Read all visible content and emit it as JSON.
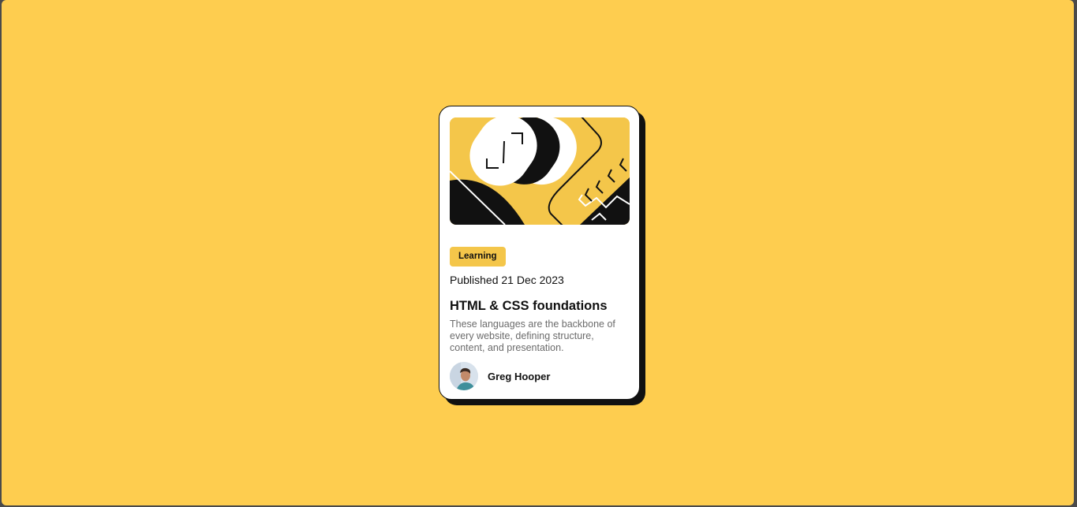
{
  "card": {
    "badge": "Learning",
    "published": "Published 21 Dec 2023",
    "title": "HTML & CSS foundations",
    "description": "These languages are the backbone of every website, defining structure, content, and presentation.",
    "author": {
      "name": "Greg Hooper"
    }
  },
  "colors": {
    "page_background": "#FECD4F",
    "accent": "#F4C64A",
    "text": "#111111",
    "muted_text": "#6b6b6b",
    "card_background": "#ffffff"
  },
  "icons": {
    "hero": "abstract-illustration",
    "avatar": "author-avatar"
  }
}
